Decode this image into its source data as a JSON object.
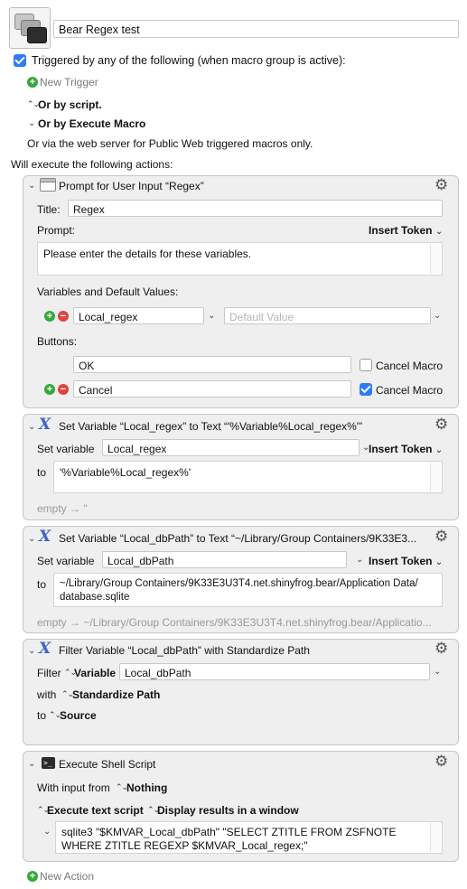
{
  "macro": {
    "name": "Bear Regex test",
    "triggered_label": "Triggered by any of the following (when macro group is active):",
    "new_trigger": "New Trigger",
    "or_by_script": "Or by script.",
    "or_by_execute_macro": "Or by Execute Macro",
    "web_server_note": "Or via the web server for Public Web triggered macros only.",
    "will_execute": "Will execute the following actions:",
    "new_action": "New Action"
  },
  "prompt_action": {
    "title": "Prompt for User Input “Regex”",
    "title_label": "Title:",
    "title_value": "Regex",
    "prompt_label": "Prompt:",
    "insert_token": "Insert Token",
    "prompt_text": "Please enter the details for these variables.",
    "variables_label": "Variables and Default Values:",
    "variable_name": "Local_regex",
    "default_placeholder": "Default Value",
    "buttons_label": "Buttons:",
    "button_ok": "OK",
    "button_cancel": "Cancel",
    "cancel_macro": "Cancel Macro"
  },
  "set_var1": {
    "title": "Set Variable “Local_regex” to Text “'%Variable%Local_regex%'”",
    "set_variable_label": "Set variable",
    "variable": "Local_regex",
    "insert_token": "Insert Token",
    "to_label": "to",
    "text": "'%Variable%Local_regex%'",
    "preview": "empty → ''"
  },
  "set_var2": {
    "title": "Set Variable “Local_dbPath” to Text “~/Library/Group Containers/9K33E3...",
    "set_variable_label": "Set variable",
    "variable": "Local_dbPath",
    "insert_token": "Insert Token",
    "to_label": "to",
    "text_line1": "~/Library/Group Containers/9K33E3U3T4.net.shinyfrog.bear/Application Data/",
    "text_line2": "database.sqlite",
    "preview": "empty → ~/Library/Group Containers/9K33E3U3T4.net.shinyfrog.bear/Applicatio..."
  },
  "filter_action": {
    "title": "Filter Variable “Local_dbPath” with Standardize Path",
    "filter_label": "Filter",
    "variable_label": "Variable",
    "variable": "Local_dbPath",
    "with_label": "with",
    "with_value": "Standardize Path",
    "to_label": "to",
    "to_value": "Source"
  },
  "shell_action": {
    "title": "Execute Shell Script",
    "with_input_label": "With input from",
    "input_value": "Nothing",
    "execute_mode": "Execute text script",
    "display_mode": "Display results in a window",
    "script_line1": "sqlite3 \"$KMVAR_Local_dbPath\" \"SELECT ZTITLE FROM ZSFNOTE",
    "script_line2": "WHERE ZTITLE REGEXP $KMVAR_Local_regex;\""
  },
  "colors": {
    "accent": "#2f7cf6",
    "plus": "#35a93a",
    "minus": "#e0443e",
    "variable_icon": "#3b66c4"
  },
  "icons": [
    "gear-icon",
    "variable-x-icon",
    "terminal-icon",
    "window-icon",
    "chevron-icon",
    "plus-icon",
    "minus-icon"
  ]
}
